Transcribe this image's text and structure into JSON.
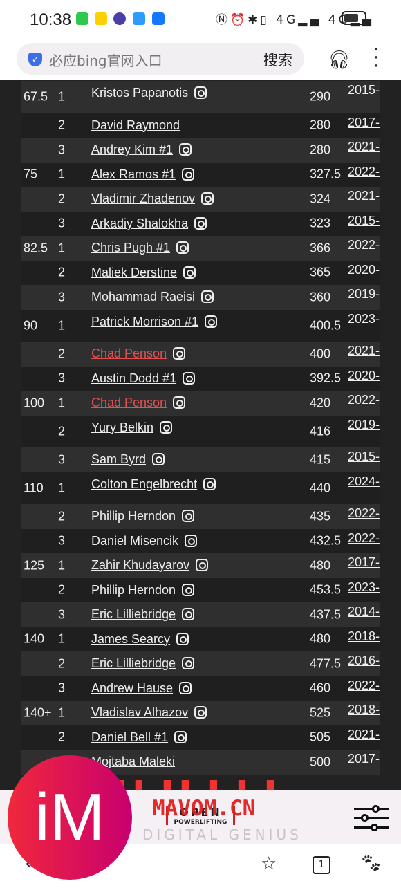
{
  "status_bar": {
    "time": "10:38",
    "apps": [
      "wechat",
      "meituan",
      "tieba",
      "message",
      "alipay"
    ],
    "icons": [
      "nfc-icon",
      "alarm-icon",
      "bluetooth-icon",
      "vibrate-icon",
      "signal-4g-icon",
      "signal-4g-icon",
      "battery-icon"
    ]
  },
  "browser": {
    "search_placeholder": "必应bing官网入口",
    "search_button": "搜索",
    "headphones_icon": "headphones-icon",
    "more_icon": "more-vertical-icon"
  },
  "table": {
    "rows": [
      {
        "weight": "67.5",
        "place": "1",
        "name": "Kristos Papanotis",
        "ig": true,
        "total": "290",
        "date": "2015-"
      },
      {
        "weight": "",
        "place": "2",
        "name": "David Raymond",
        "ig": false,
        "total": "280",
        "date": "2017-"
      },
      {
        "weight": "",
        "place": "3",
        "name": "Andrey Kim #1",
        "ig": true,
        "total": "280",
        "date": "2021-"
      },
      {
        "weight": "75",
        "place": "1",
        "name": "Alex Ramos #1",
        "ig": true,
        "total": "327.5",
        "date": "2022-"
      },
      {
        "weight": "",
        "place": "2",
        "name": "Vladimir Zhadenov",
        "ig": true,
        "total": "324",
        "date": "2021-"
      },
      {
        "weight": "",
        "place": "3",
        "name": "Arkadiy Shalokha",
        "ig": true,
        "total": "323",
        "date": "2015-"
      },
      {
        "weight": "82.5",
        "place": "1",
        "name": "Chris Pugh #1",
        "ig": true,
        "total": "366",
        "date": "2022-"
      },
      {
        "weight": "",
        "place": "2",
        "name": "Maliek Derstine",
        "ig": true,
        "total": "365",
        "date": "2020-"
      },
      {
        "weight": "",
        "place": "3",
        "name": "Mohammad Raeisi",
        "ig": true,
        "total": "360",
        "date": "2019-"
      },
      {
        "weight": "90",
        "place": "1",
        "name": "Patrick Morrison #1",
        "ig": true,
        "total": "400.5",
        "date": "2023-"
      },
      {
        "weight": "",
        "place": "2",
        "name": "Chad Penson",
        "ig": true,
        "highlight": true,
        "total": "400",
        "date": "2021-"
      },
      {
        "weight": "",
        "place": "3",
        "name": "Austin Dodd #1",
        "ig": true,
        "total": "392.5",
        "date": "2020-"
      },
      {
        "weight": "100",
        "place": "1",
        "name": "Chad Penson",
        "ig": true,
        "highlight": true,
        "total": "420",
        "date": "2022-"
      },
      {
        "weight": "",
        "place": "2",
        "name": "Yury Belkin",
        "ig": true,
        "total": "416",
        "date": "2019-"
      },
      {
        "weight": "",
        "place": "3",
        "name": "Sam Byrd",
        "ig": true,
        "total": "415",
        "date": "2015-"
      },
      {
        "weight": "110",
        "place": "1",
        "name": "Colton Engelbrecht",
        "ig": true,
        "total": "440",
        "date": "2024-"
      },
      {
        "weight": "",
        "place": "2",
        "name": "Phillip Herndon",
        "ig": true,
        "total": "435",
        "date": "2022-"
      },
      {
        "weight": "",
        "place": "3",
        "name": "Daniel Misencik",
        "ig": true,
        "total": "432.5",
        "date": "2022-"
      },
      {
        "weight": "125",
        "place": "1",
        "name": "Zahir Khudayarov",
        "ig": true,
        "total": "480",
        "date": "2017-"
      },
      {
        "weight": "",
        "place": "2",
        "name": "Phillip Herndon",
        "ig": true,
        "total": "453.5",
        "date": "2023-"
      },
      {
        "weight": "",
        "place": "3",
        "name": "Eric Lilliebridge",
        "ig": true,
        "total": "437.5",
        "date": "2014-"
      },
      {
        "weight": "140",
        "place": "1",
        "name": "James Searcy",
        "ig": true,
        "total": "480",
        "date": "2018-"
      },
      {
        "weight": "",
        "place": "2",
        "name": "Eric Lilliebridge",
        "ig": true,
        "total": "477.5",
        "date": "2016-"
      },
      {
        "weight": "",
        "place": "3",
        "name": "Andrew Hause",
        "ig": true,
        "total": "460",
        "date": "2022-"
      },
      {
        "weight": "140+",
        "place": "1",
        "name": "Vladislav Alhazov",
        "ig": true,
        "total": "525",
        "date": "2018-"
      },
      {
        "weight": "",
        "place": "2",
        "name": "Daniel Bell #1",
        "ig": true,
        "total": "505",
        "date": "2021-"
      },
      {
        "weight": "",
        "place": "3",
        "name": "Mojtaba Maleki",
        "ig": false,
        "total": "500",
        "date": "2017-"
      }
    ],
    "highlight_color": "#e05050"
  },
  "banner": {
    "logo_top": "OPEN",
    "logo_bottom": "POWERLIFTING",
    "watermark": "MAVOM.CN",
    "tagline": "DIGITAL GENIUS",
    "filter_icon": "sliders-icon"
  },
  "overlay": {
    "badge": "iM"
  },
  "nav": {
    "tab_count": "1",
    "icons": [
      "back-icon",
      "star-icon",
      "tabs-icon",
      "baidu-paw-icon"
    ]
  }
}
